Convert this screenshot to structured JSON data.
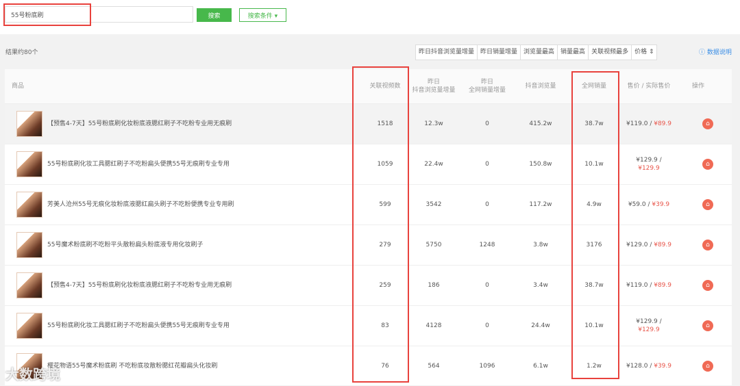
{
  "search": {
    "value": "55号粉底刷",
    "button": "搜索",
    "conditions": "搜索条件 ▾"
  },
  "result_count": "结果约80个",
  "sort_tabs": [
    "昨日抖音浏览量增量",
    "昨日销量增量",
    "浏览量最高",
    "销量最高",
    "关联视频最多",
    "价格 ⇕"
  ],
  "active_sort_index": 4,
  "help_link": "ⓘ 数据说明",
  "columns": {
    "product": "商品",
    "videos": "关联视频数",
    "views_inc_1": "昨日",
    "views_inc_2": "抖音浏览量增量",
    "sales_inc_1": "昨日",
    "sales_inc_2": "全网销量增量",
    "views": "抖音浏览量",
    "sales": "全网销量",
    "price": "售价 / 实际售价",
    "op": "操作"
  },
  "rows": [
    {
      "name": "【预售4-7天】55号粉底刷化妆粉底液腮红刷子不吃粉专业用无痕刷",
      "videos": "1518",
      "views_inc": "12.3w",
      "sales_inc": "0",
      "views": "415.2w",
      "sales": "38.7w",
      "price": "¥119.0 / ",
      "sale_price": "¥89.9"
    },
    {
      "name": "55号粉底刷化妆工具腮红刷子不吃粉扁头便携55号无痕刷专业专用",
      "videos": "1059",
      "views_inc": "22.4w",
      "sales_inc": "0",
      "views": "150.8w",
      "sales": "10.1w",
      "price": "¥129.9 /",
      "sale_price": "¥129.9"
    },
    {
      "name": "芳美人沧州55号无痕化妆粉底液腮红扁头刷子不吃粉便携专业专用刷",
      "videos": "599",
      "views_inc": "3542",
      "sales_inc": "0",
      "views": "117.2w",
      "sales": "4.9w",
      "price": "¥59.0 / ",
      "sale_price": "¥39.9"
    },
    {
      "name": "55号魔术粉底刷不吃粉平头散粉扁头粉底液专用化妆刷子",
      "videos": "279",
      "views_inc": "5750",
      "sales_inc": "1248",
      "views": "3.8w",
      "sales": "3176",
      "price": "¥129.0 / ",
      "sale_price": "¥89.9"
    },
    {
      "name": "【预售4-7天】55号粉底刷化妆粉底液腮红刷子不吃粉专业用无痕刷",
      "videos": "259",
      "views_inc": "186",
      "sales_inc": "0",
      "views": "3.4w",
      "sales": "38.7w",
      "price": "¥119.0 / ",
      "sale_price": "¥89.9"
    },
    {
      "name": "55号粉底刷化妆工具腮红刷子不吃粉扁头便携55号无痕刷专业专用",
      "videos": "83",
      "views_inc": "4128",
      "sales_inc": "0",
      "views": "24.4w",
      "sales": "10.1w",
      "price": "¥129.9 /",
      "sale_price": "¥129.9"
    },
    {
      "name": "樱花物语55号魔术粉底刷 不吃粉底妆散粉腮红花瓣扁头化妆刷",
      "videos": "76",
      "views_inc": "564",
      "sales_inc": "1096",
      "views": "6.1w",
      "sales": "1.2w",
      "price": "¥128.0 / ",
      "sale_price": "¥39.9"
    }
  ],
  "watermark": "大数跨境",
  "colors": {
    "accent": "#47b84b",
    "highlight_box": "#e8413c",
    "sale_price": "#e8554a",
    "op_icon": "#f06a55"
  },
  "icons": {
    "op": "shopping-bag-icon",
    "help": "info-circle-icon"
  }
}
